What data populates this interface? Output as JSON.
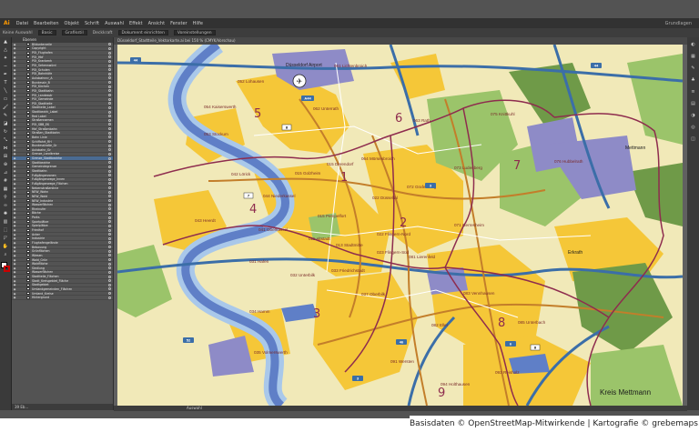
{
  "app": {
    "logo": "Ai",
    "menu": [
      "Datei",
      "Bearbeiten",
      "Objekt",
      "Schrift",
      "Auswahl",
      "Effekt",
      "Ansicht",
      "Fenster",
      "Hilfe"
    ],
    "workspace": "Grundlagen"
  },
  "controlbar": {
    "selection": "Keine Auswahl",
    "stroke_profile": "Basic",
    "style": "Grafikstil",
    "opacity": "Deckkraft",
    "doc_setup": "Dokument einrichten",
    "preferences": "Voreinstellungen"
  },
  "document": {
    "tab": "Düsseldorf_Stadtteile_Vektorkarte.ai bei 150 % (CMYK/Vorschau)",
    "zoom": "150 %",
    "status": "Auswahl"
  },
  "layers": {
    "header": "Ebenen",
    "footer": "39 Eb...",
    "items": [
      {
        "name": "Bildunterzeile"
      },
      {
        "name": "Copyright"
      },
      {
        "name": "POI_Flughafen"
      },
      {
        "name": "POI_Hbf"
      },
      {
        "name": "POI_Krankenh"
      },
      {
        "name": "POI_Sehenswürd"
      },
      {
        "name": "POI_Schulen"
      },
      {
        "name": "POI_Bahnhöfe"
      },
      {
        "name": "Autobahnnr_A"
      },
      {
        "name": "Bundesstr_B"
      },
      {
        "name": "POI_Kirchen"
      },
      {
        "name": "POI_Stadtbahn"
      },
      {
        "name": "POI_Landesstr"
      },
      {
        "name": "POI_Gemeinde"
      },
      {
        "name": "POI_Stadtteile"
      },
      {
        "name": "Stadtteile_Label"
      },
      {
        "name": "Stadtbezirk_Label"
      },
      {
        "name": "Red Label"
      },
      {
        "name": "Straßennamen"
      },
      {
        "name": "POI_SBB_EK"
      },
      {
        "name": "Hbf_Straßenbahn"
      },
      {
        "name": "Straßen_Stadtbahn"
      },
      {
        "name": "Bahn Linie"
      },
      {
        "name": "Schiffahrt_RH"
      },
      {
        "name": "Bundesstraße_Gr"
      },
      {
        "name": "Autobahn_Gr"
      },
      {
        "name": "Grenze_Landkreise"
      },
      {
        "name": "Grenze_Stadtbezirke",
        "selected": true
      },
      {
        "name": "Stadtbezirke"
      },
      {
        "name": "Gemeindegrenze"
      },
      {
        "name": "Stadtbahn"
      },
      {
        "name": "Fußgängerzonen"
      },
      {
        "name": "Fußgängerwege_Innen"
      },
      {
        "name": "Fußgängerwege_Flächen"
      },
      {
        "name": "Nebenstraßenlinie"
      },
      {
        "name": "NEW_Wohn"
      },
      {
        "name": "NEW_Wald"
      },
      {
        "name": "NEW_Industrie"
      },
      {
        "name": "Wasserflächen"
      },
      {
        "name": "Rheinufer"
      },
      {
        "name": "Bäche"
      },
      {
        "name": "Parks"
      },
      {
        "name": "Sportplätze"
      },
      {
        "name": "Spielplätze"
      },
      {
        "name": "Friedhof"
      },
      {
        "name": "Acker"
      },
      {
        "name": "Industrie"
      },
      {
        "name": "Flughafengelände"
      },
      {
        "name": "Bebauung"
      },
      {
        "name": "Grünflächen"
      },
      {
        "name": "Wiesen"
      },
      {
        "name": "Wald_Grün"
      },
      {
        "name": "Waldfläche"
      },
      {
        "name": "Siedlung"
      },
      {
        "name": "Wasserflächen"
      },
      {
        "name": "Stadtteile_Flächen"
      },
      {
        "name": "Stadt_Kreisgebiet_Fläche"
      },
      {
        "name": "Stadtgebiet"
      },
      {
        "name": "Umlandgemeinden_Flächen"
      },
      {
        "name": "Umland_Kreise"
      },
      {
        "name": "Hintergrund"
      }
    ]
  },
  "map": {
    "colors": {
      "background": "#f1e9b8",
      "residential": "#f5c738",
      "forest": "#9bc46a",
      "forest_dark": "#6f9a48",
      "water": "#5f7fc7",
      "water_light": "#a9c8ea",
      "industry": "#8e8bc7",
      "border": "#8e2c4e",
      "motorway": "#3b6ea8",
      "main_road": "#c37e2a",
      "road": "#ffffff"
    },
    "district_numbers": [
      "1",
      "2",
      "3",
      "4",
      "5",
      "6",
      "7",
      "8",
      "9"
    ],
    "places": [
      "Düsseldorf Airport",
      "061 Lichtenbroich",
      "052 Lohausen",
      "062 Unterrath",
      "054 Kaiserswerth",
      "053 Stockum",
      "075 Knittkuhl",
      "063 Rath",
      "064 Mörsenbroich",
      "072 Grafenberg",
      "073 Ludenberg",
      "076 Hubbelrath",
      "015 Golzheim",
      "015 Derendorf",
      "015 Pempelfort",
      "042 Lörick",
      "044 Niederkassel",
      "043 Heerdt",
      "041 Oberkassel",
      "022 Düsseltal",
      "022 Flingern-Nord",
      "023 Flingern-Süd",
      "071 Gerresheim",
      "013 Stadtmitte",
      "011 Altstadt",
      "031 Hafen",
      "032 Unterbilk",
      "033 Friedrichstadt",
      "081 Lierenfeld",
      "083 Vennhausen",
      "037 Oberbilk",
      "034 Hamm",
      "035 Volmerswerth",
      "082 Eller",
      "085 Unterbach",
      "Erkrath",
      "Mettmann",
      "091 Wersten",
      "094 Holthausen",
      "093 Reisholz",
      "Kreis Mettmann"
    ],
    "route_numbers": [
      "44",
      "A44",
      "8",
      "7",
      "52",
      "3",
      "46",
      "6",
      "8",
      "44",
      "3"
    ]
  },
  "credit": "Basisdaten © OpenStreetMap-Mitwirkende | Kartografie © grebemaps.de"
}
